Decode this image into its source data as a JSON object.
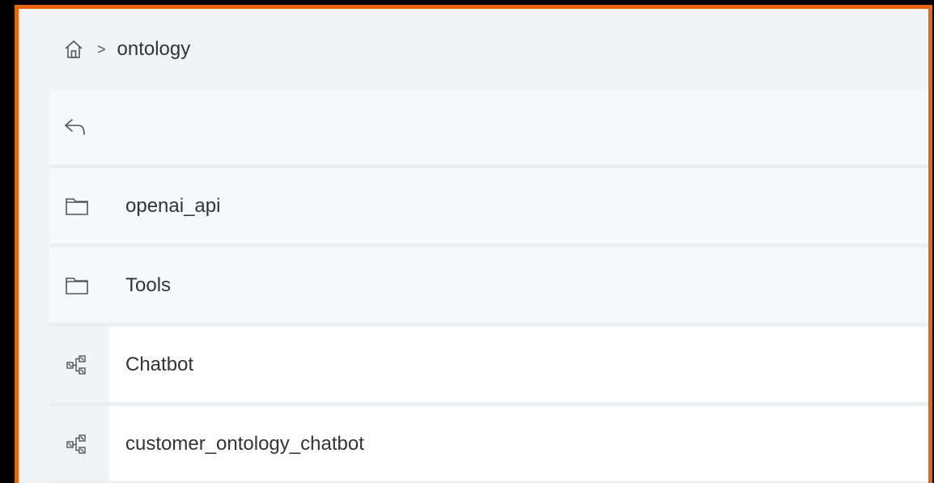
{
  "breadcrumb": {
    "home_icon": "home-icon",
    "separator": ">",
    "current": "ontology"
  },
  "back": {
    "icon": "back-arrow-icon"
  },
  "items": [
    {
      "label": "openai_api",
      "icon": "folder-icon",
      "type": "folder"
    },
    {
      "label": "Tools",
      "icon": "folder-icon",
      "type": "folder"
    },
    {
      "label": "Chatbot",
      "icon": "workflow-icon",
      "type": "workflow"
    },
    {
      "label": "customer_ontology_chatbot",
      "icon": "workflow-icon",
      "type": "workflow"
    }
  ],
  "colors": {
    "accent_border": "#e8650b"
  }
}
